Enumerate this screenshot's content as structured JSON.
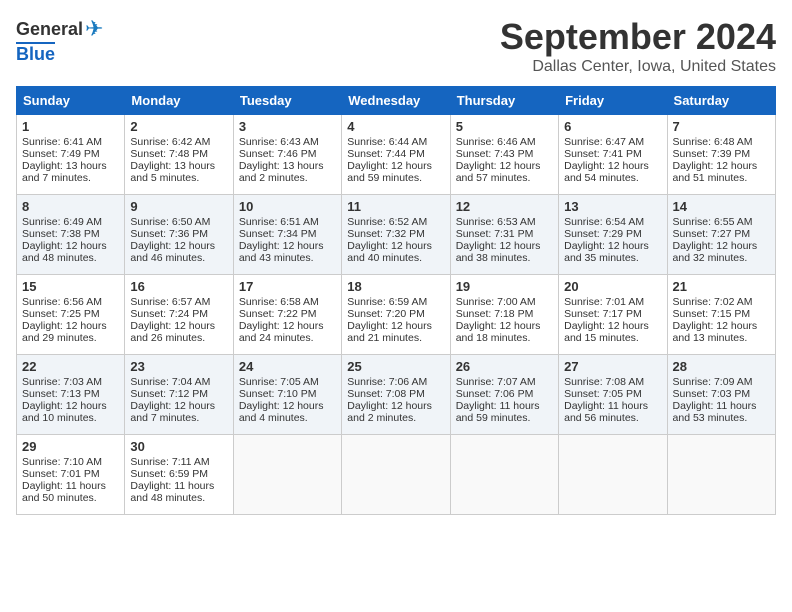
{
  "header": {
    "logo_general": "General",
    "logo_blue": "Blue",
    "month": "September 2024",
    "location": "Dallas Center, Iowa, United States"
  },
  "weekdays": [
    "Sunday",
    "Monday",
    "Tuesday",
    "Wednesday",
    "Thursday",
    "Friday",
    "Saturday"
  ],
  "weeks": [
    [
      {
        "day": "1",
        "sunrise": "Sunrise: 6:41 AM",
        "sunset": "Sunset: 7:49 PM",
        "daylight": "Daylight: 13 hours and 7 minutes."
      },
      {
        "day": "2",
        "sunrise": "Sunrise: 6:42 AM",
        "sunset": "Sunset: 7:48 PM",
        "daylight": "Daylight: 13 hours and 5 minutes."
      },
      {
        "day": "3",
        "sunrise": "Sunrise: 6:43 AM",
        "sunset": "Sunset: 7:46 PM",
        "daylight": "Daylight: 13 hours and 2 minutes."
      },
      {
        "day": "4",
        "sunrise": "Sunrise: 6:44 AM",
        "sunset": "Sunset: 7:44 PM",
        "daylight": "Daylight: 12 hours and 59 minutes."
      },
      {
        "day": "5",
        "sunrise": "Sunrise: 6:46 AM",
        "sunset": "Sunset: 7:43 PM",
        "daylight": "Daylight: 12 hours and 57 minutes."
      },
      {
        "day": "6",
        "sunrise": "Sunrise: 6:47 AM",
        "sunset": "Sunset: 7:41 PM",
        "daylight": "Daylight: 12 hours and 54 minutes."
      },
      {
        "day": "7",
        "sunrise": "Sunrise: 6:48 AM",
        "sunset": "Sunset: 7:39 PM",
        "daylight": "Daylight: 12 hours and 51 minutes."
      }
    ],
    [
      {
        "day": "8",
        "sunrise": "Sunrise: 6:49 AM",
        "sunset": "Sunset: 7:38 PM",
        "daylight": "Daylight: 12 hours and 48 minutes."
      },
      {
        "day": "9",
        "sunrise": "Sunrise: 6:50 AM",
        "sunset": "Sunset: 7:36 PM",
        "daylight": "Daylight: 12 hours and 46 minutes."
      },
      {
        "day": "10",
        "sunrise": "Sunrise: 6:51 AM",
        "sunset": "Sunset: 7:34 PM",
        "daylight": "Daylight: 12 hours and 43 minutes."
      },
      {
        "day": "11",
        "sunrise": "Sunrise: 6:52 AM",
        "sunset": "Sunset: 7:32 PM",
        "daylight": "Daylight: 12 hours and 40 minutes."
      },
      {
        "day": "12",
        "sunrise": "Sunrise: 6:53 AM",
        "sunset": "Sunset: 7:31 PM",
        "daylight": "Daylight: 12 hours and 38 minutes."
      },
      {
        "day": "13",
        "sunrise": "Sunrise: 6:54 AM",
        "sunset": "Sunset: 7:29 PM",
        "daylight": "Daylight: 12 hours and 35 minutes."
      },
      {
        "day": "14",
        "sunrise": "Sunrise: 6:55 AM",
        "sunset": "Sunset: 7:27 PM",
        "daylight": "Daylight: 12 hours and 32 minutes."
      }
    ],
    [
      {
        "day": "15",
        "sunrise": "Sunrise: 6:56 AM",
        "sunset": "Sunset: 7:25 PM",
        "daylight": "Daylight: 12 hours and 29 minutes."
      },
      {
        "day": "16",
        "sunrise": "Sunrise: 6:57 AM",
        "sunset": "Sunset: 7:24 PM",
        "daylight": "Daylight: 12 hours and 26 minutes."
      },
      {
        "day": "17",
        "sunrise": "Sunrise: 6:58 AM",
        "sunset": "Sunset: 7:22 PM",
        "daylight": "Daylight: 12 hours and 24 minutes."
      },
      {
        "day": "18",
        "sunrise": "Sunrise: 6:59 AM",
        "sunset": "Sunset: 7:20 PM",
        "daylight": "Daylight: 12 hours and 21 minutes."
      },
      {
        "day": "19",
        "sunrise": "Sunrise: 7:00 AM",
        "sunset": "Sunset: 7:18 PM",
        "daylight": "Daylight: 12 hours and 18 minutes."
      },
      {
        "day": "20",
        "sunrise": "Sunrise: 7:01 AM",
        "sunset": "Sunset: 7:17 PM",
        "daylight": "Daylight: 12 hours and 15 minutes."
      },
      {
        "day": "21",
        "sunrise": "Sunrise: 7:02 AM",
        "sunset": "Sunset: 7:15 PM",
        "daylight": "Daylight: 12 hours and 13 minutes."
      }
    ],
    [
      {
        "day": "22",
        "sunrise": "Sunrise: 7:03 AM",
        "sunset": "Sunset: 7:13 PM",
        "daylight": "Daylight: 12 hours and 10 minutes."
      },
      {
        "day": "23",
        "sunrise": "Sunrise: 7:04 AM",
        "sunset": "Sunset: 7:12 PM",
        "daylight": "Daylight: 12 hours and 7 minutes."
      },
      {
        "day": "24",
        "sunrise": "Sunrise: 7:05 AM",
        "sunset": "Sunset: 7:10 PM",
        "daylight": "Daylight: 12 hours and 4 minutes."
      },
      {
        "day": "25",
        "sunrise": "Sunrise: 7:06 AM",
        "sunset": "Sunset: 7:08 PM",
        "daylight": "Daylight: 12 hours and 2 minutes."
      },
      {
        "day": "26",
        "sunrise": "Sunrise: 7:07 AM",
        "sunset": "Sunset: 7:06 PM",
        "daylight": "Daylight: 11 hours and 59 minutes."
      },
      {
        "day": "27",
        "sunrise": "Sunrise: 7:08 AM",
        "sunset": "Sunset: 7:05 PM",
        "daylight": "Daylight: 11 hours and 56 minutes."
      },
      {
        "day": "28",
        "sunrise": "Sunrise: 7:09 AM",
        "sunset": "Sunset: 7:03 PM",
        "daylight": "Daylight: 11 hours and 53 minutes."
      }
    ],
    [
      {
        "day": "29",
        "sunrise": "Sunrise: 7:10 AM",
        "sunset": "Sunset: 7:01 PM",
        "daylight": "Daylight: 11 hours and 50 minutes."
      },
      {
        "day": "30",
        "sunrise": "Sunrise: 7:11 AM",
        "sunset": "Sunset: 6:59 PM",
        "daylight": "Daylight: 11 hours and 48 minutes."
      },
      null,
      null,
      null,
      null,
      null
    ]
  ]
}
